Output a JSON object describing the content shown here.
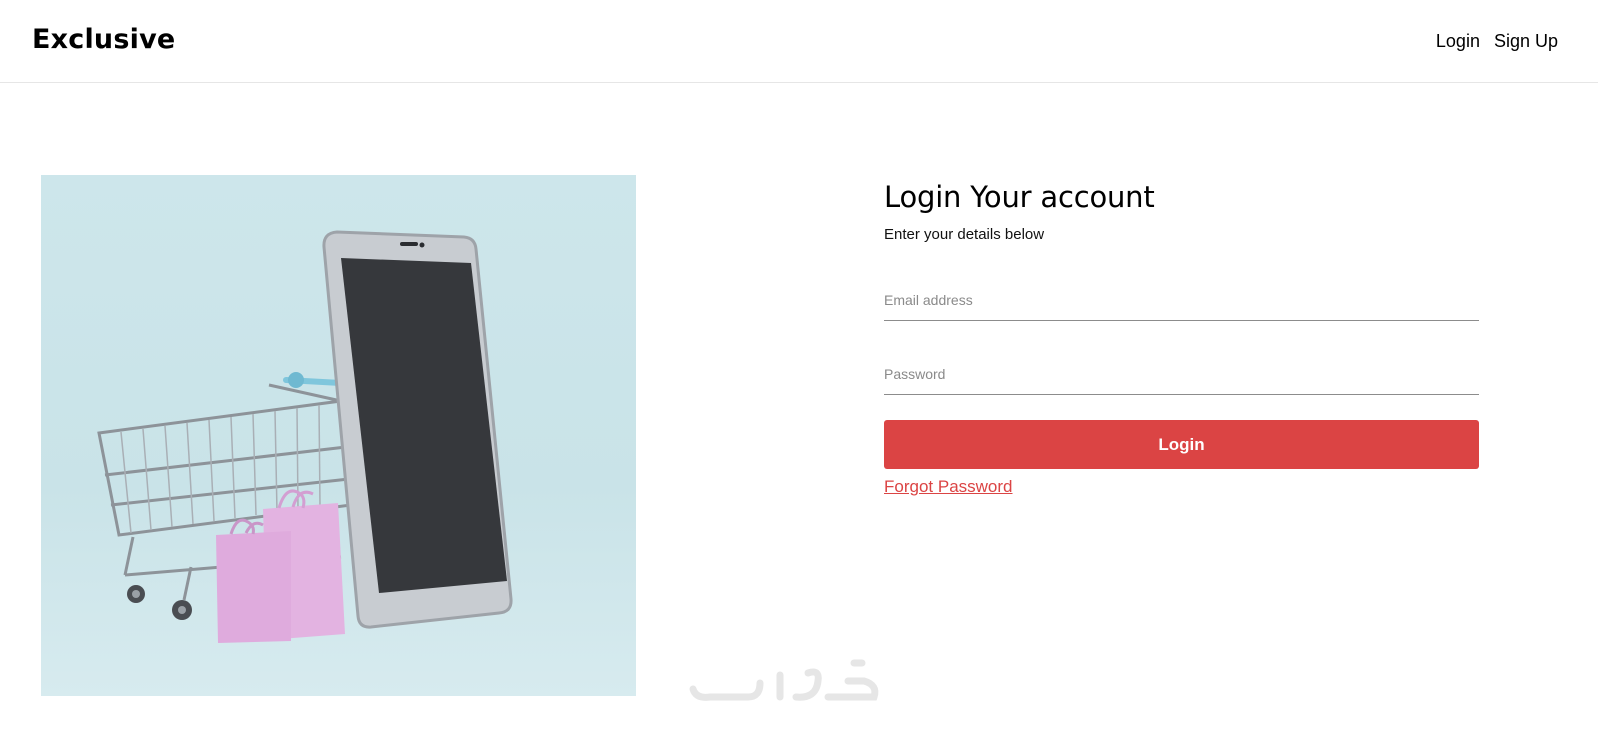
{
  "header": {
    "logo": "Exclusive",
    "nav": {
      "login": "Login",
      "signup": "Sign Up"
    }
  },
  "hero": {
    "image_description_icon": "shopping-cart-phone-illustration"
  },
  "form": {
    "title": "Login Your account",
    "subtitle": "Enter your details below",
    "email_placeholder": "Email address",
    "password_placeholder": "Password",
    "login_button": "Login",
    "forgot_link": "Forgot Password"
  },
  "colors": {
    "accent": "#db4444",
    "hero_bg": "#cde6eb",
    "phone_screen": "#36383c",
    "bags": "#e3b3e1"
  },
  "watermark": {
    "text": "خمسات"
  }
}
